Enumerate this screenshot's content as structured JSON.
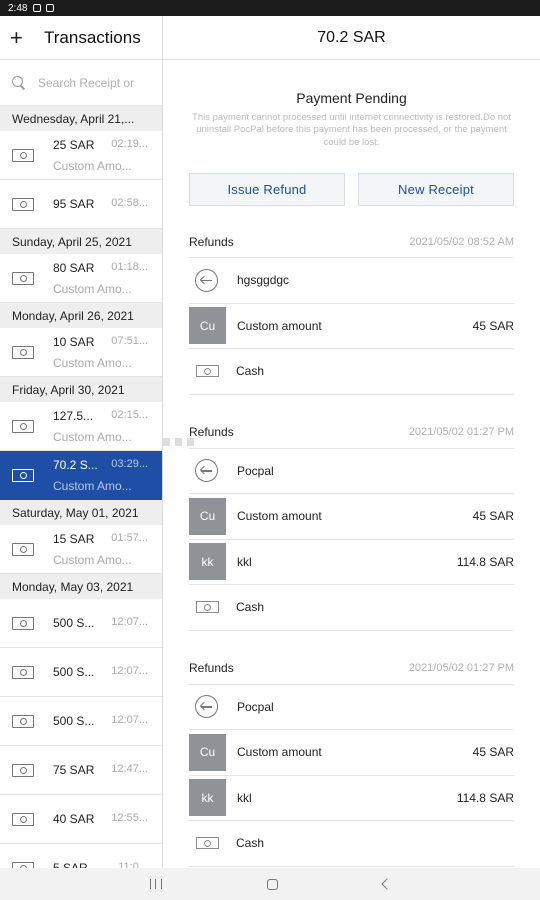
{
  "status_bar": {
    "time": "2:48"
  },
  "left": {
    "title": "Transactions",
    "search_placeholder": "Search Receipt or",
    "groups": [
      {
        "date": "Wednesday, April 21,...",
        "items": [
          {
            "amount": "25 SAR",
            "time": "02:19...",
            "sub": "Custom Amo..."
          },
          {
            "amount": "95 SAR",
            "time": "02:58...",
            "sub": ""
          }
        ]
      },
      {
        "date": "Sunday, April 25, 2021",
        "items": [
          {
            "amount": "80 SAR",
            "time": "01:18...",
            "sub": "Custom Amo..."
          }
        ]
      },
      {
        "date": "Monday, April 26, 2021",
        "items": [
          {
            "amount": "10 SAR",
            "time": "07:51...",
            "sub": "Custom Amo..."
          }
        ]
      },
      {
        "date": "Friday, April 30, 2021",
        "items": [
          {
            "amount": "127.5...",
            "time": "02:15...",
            "sub": "Custom Amo..."
          },
          {
            "amount": "70.2 S...",
            "time": "03:29...",
            "sub": "Custom Amo...",
            "selected": true
          }
        ]
      },
      {
        "date": "Saturday, May 01, 2021",
        "items": [
          {
            "amount": "15 SAR",
            "time": "01:57...",
            "sub": "Custom Amo..."
          }
        ]
      },
      {
        "date": "Monday, May 03, 2021",
        "items": [
          {
            "amount": "500 S...",
            "time": "12:07...",
            "sub": ""
          },
          {
            "amount": "500 S...",
            "time": "12:07...",
            "sub": ""
          },
          {
            "amount": "500 S...",
            "time": "12:07...",
            "sub": ""
          },
          {
            "amount": "75 SAR",
            "time": "12:47...",
            "sub": ""
          },
          {
            "amount": "40 SAR",
            "time": "12:55...",
            "sub": ""
          },
          {
            "amount": "5 SAR",
            "time": "11:0...",
            "sub": ""
          }
        ]
      }
    ]
  },
  "right": {
    "title": "70.2 SAR",
    "status_title": "Payment Pending",
    "status_message": "This payment cannot processed until internet connectivity is restored.Do not uninstall PocPal before this payment has been processed, or the payment could be lost.",
    "issue_refund_label": "Issue Refund",
    "new_receipt_label": "New Receipt",
    "refunds": [
      {
        "label": "Refunds",
        "date": "2021/05/02 08:52 AM",
        "note": "hgsggdgc",
        "items": [
          {
            "initials": "Cu",
            "name": "Custom amount",
            "amount": "45 SAR"
          }
        ],
        "payment": "Cash"
      },
      {
        "label": "Refunds",
        "date": "2021/05/02 01:27 PM",
        "note": "Pocpal",
        "items": [
          {
            "initials": "Cu",
            "name": "Custom amount",
            "amount": "45 SAR"
          },
          {
            "initials": "kk",
            "name": "kkl",
            "amount": "114.8 SAR"
          }
        ],
        "payment": "Cash"
      },
      {
        "label": "Refunds",
        "date": "2021/05/02 01:27 PM",
        "note": "Pocpal",
        "items": [
          {
            "initials": "Cu",
            "name": "Custom amount",
            "amount": "45 SAR"
          },
          {
            "initials": "kk",
            "name": "kkl",
            "amount": "114.8 SAR"
          }
        ],
        "payment": "Cash"
      }
    ]
  }
}
